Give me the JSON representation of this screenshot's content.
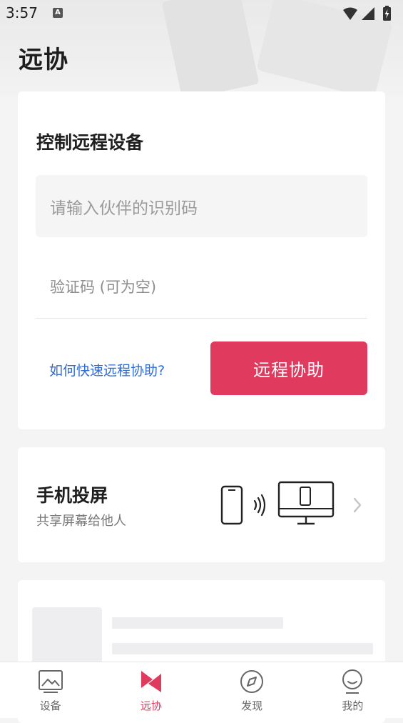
{
  "status_bar": {
    "time": "3:57",
    "notification_badge": "A"
  },
  "page": {
    "title": "远协"
  },
  "control_card": {
    "title": "控制远程设备",
    "partner_id_placeholder": "请输入伙伴的识别码",
    "verification_placeholder": "验证码 (可为空)",
    "help_link": "如何快速远程协助?",
    "assist_button": "远程协助"
  },
  "screencast_card": {
    "title": "手机投屏",
    "subtitle": "共享屏幕给他人"
  },
  "tabbar": {
    "tabs": [
      {
        "label": "设备",
        "icon": "image-icon"
      },
      {
        "label": "远协",
        "icon": "remote-assist-icon",
        "active": true
      },
      {
        "label": "发现",
        "icon": "compass-icon"
      },
      {
        "label": "我的",
        "icon": "user-face-icon"
      }
    ]
  },
  "colors": {
    "accent": "#e03a5f",
    "link": "#2f6bd3",
    "background": "#f4f4f5"
  }
}
